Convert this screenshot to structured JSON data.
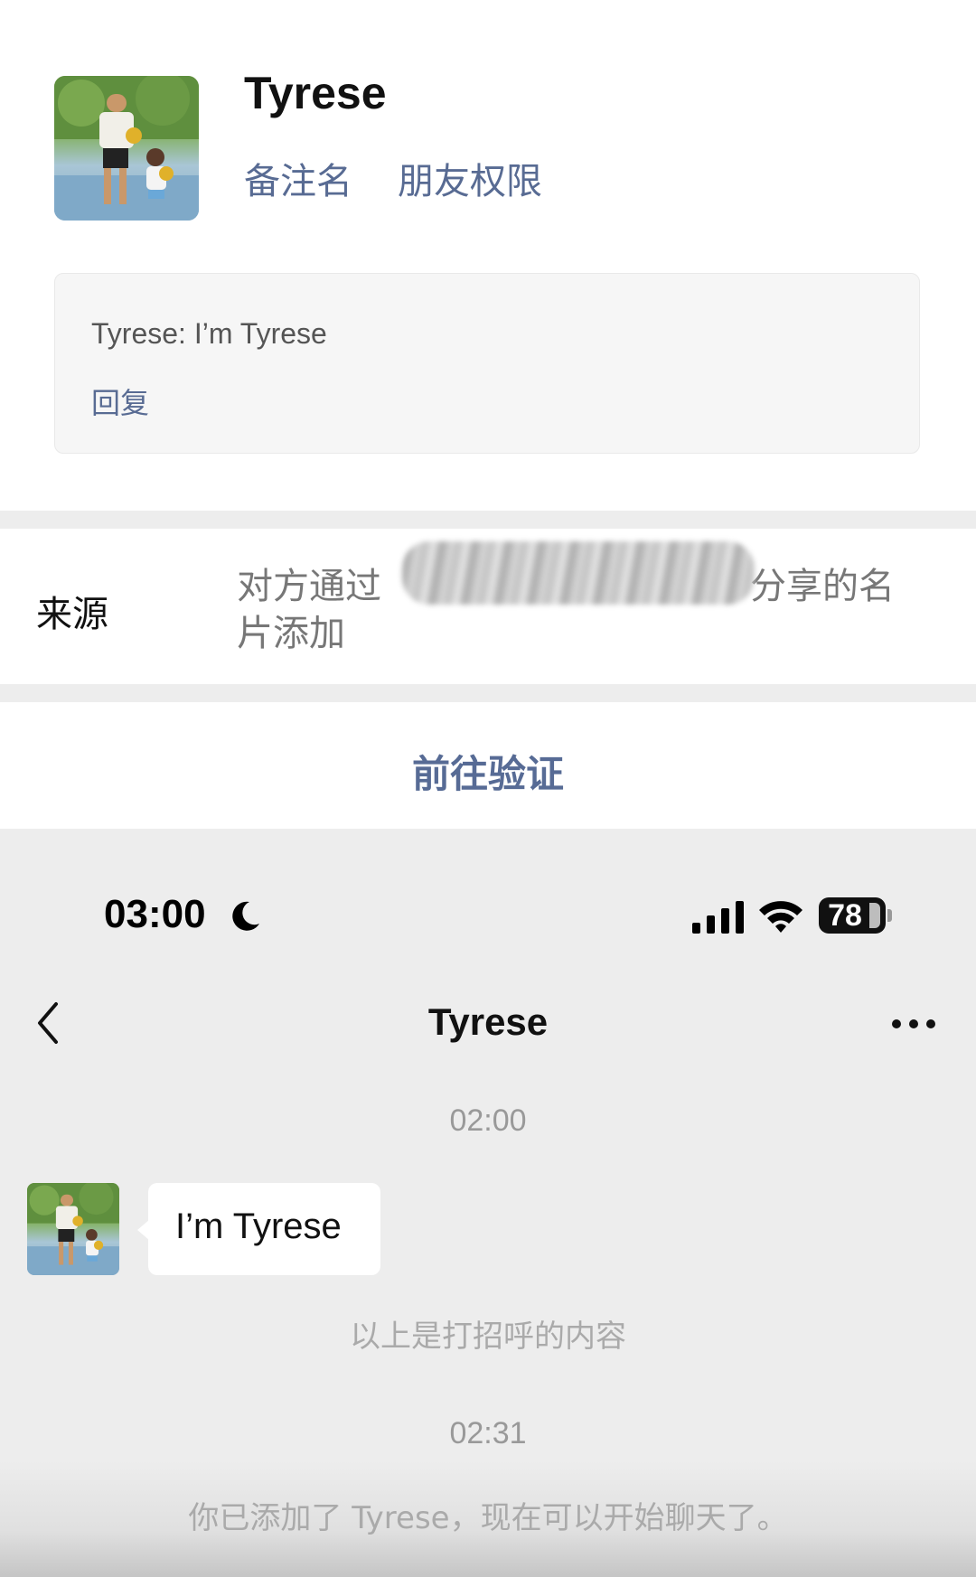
{
  "profile": {
    "name": "Tyrese",
    "links": [
      "备注名",
      "朋友权限"
    ],
    "greeting": "Tyrese: I’m Tyrese",
    "reply_label": "回复"
  },
  "source": {
    "label": "来源",
    "value_prefix": "对方通过",
    "value_suffix": "分享的名片添加"
  },
  "verify_label": "前往验证",
  "status_bar": {
    "time": "03:00",
    "battery": "78"
  },
  "chat": {
    "title": "Tyrese",
    "timestamp1": "02:00",
    "message": "I’m Tyrese",
    "system_note1": "以上是打招呼的内容",
    "timestamp2": "02:31",
    "system_note2": "你已添加了 Tyrese，现在可以开始聊天了。"
  },
  "colors": {
    "link": "#586b93",
    "verify": "#576b95",
    "chat_bg": "#ededed"
  },
  "icons": [
    "moon-icon",
    "signal-icon",
    "wifi-icon",
    "battery-icon",
    "back-arrow-icon",
    "more-icon"
  ]
}
